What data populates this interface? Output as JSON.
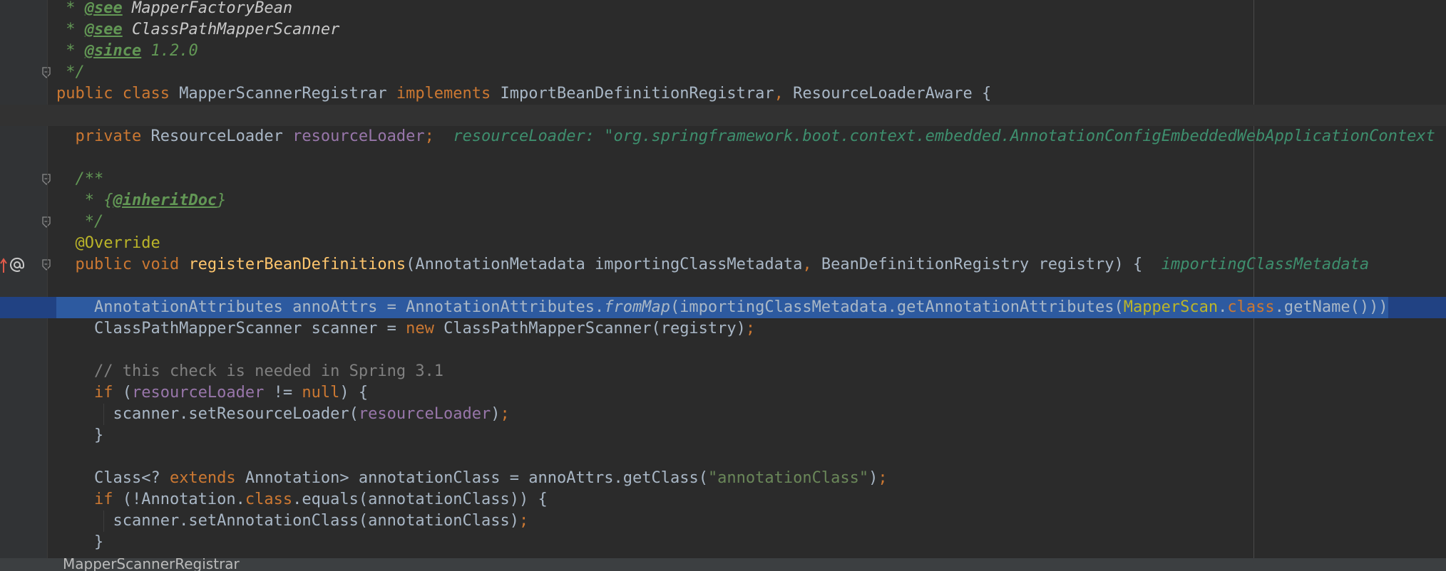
{
  "editor": {
    "lines": [
      {
        "spans": [
          {
            "t": " * ",
            "c": "doc"
          },
          {
            "t": "@see",
            "c": "doctag"
          },
          {
            "t": " MapperFactoryBean",
            "c": "docref"
          }
        ]
      },
      {
        "spans": [
          {
            "t": " * ",
            "c": "doc"
          },
          {
            "t": "@see",
            "c": "doctag"
          },
          {
            "t": " ClassPathMapperScanner",
            "c": "docref"
          }
        ]
      },
      {
        "spans": [
          {
            "t": " * ",
            "c": "doc"
          },
          {
            "t": "@since",
            "c": "doctag"
          },
          {
            "t": " 1.2.0",
            "c": "doc"
          }
        ]
      },
      {
        "spans": [
          {
            "t": " */",
            "c": "doc"
          }
        ]
      },
      {
        "spans": [
          {
            "t": "public class ",
            "c": "kw"
          },
          {
            "t": "MapperScannerRegistrar ",
            "c": "cls"
          },
          {
            "t": "implements ",
            "c": "kw"
          },
          {
            "t": "ImportBeanDefinitionRegistrar",
            "c": "cls"
          },
          {
            "t": ", ",
            "c": "kw"
          },
          {
            "t": "ResourceLoaderAware {",
            "c": "cls"
          }
        ]
      },
      {
        "spans": []
      },
      {
        "spans": [
          {
            "t": "  private ",
            "c": "kw"
          },
          {
            "t": "ResourceLoader ",
            "c": "cls"
          },
          {
            "t": "resourceLoader",
            "c": "fld"
          },
          {
            "t": ";",
            "c": "kw"
          },
          {
            "t": "  resourceLoader: \"org.springframework.boot.context.embedded.AnnotationConfigEmbeddedWebApplicationContext",
            "c": "hint"
          }
        ]
      },
      {
        "spans": []
      },
      {
        "spans": [
          {
            "t": "  /**",
            "c": "doc"
          }
        ]
      },
      {
        "spans": [
          {
            "t": "   * {",
            "c": "doc"
          },
          {
            "t": "@inheritDoc",
            "c": "doctag"
          },
          {
            "t": "}",
            "c": "doc"
          }
        ]
      },
      {
        "spans": [
          {
            "t": "   */",
            "c": "doc"
          }
        ]
      },
      {
        "spans": [
          {
            "t": "  @Override",
            "c": "ann"
          }
        ]
      },
      {
        "spans": [
          {
            "t": "  public void ",
            "c": "kw"
          },
          {
            "t": "registerBeanDefinitions",
            "c": "fn"
          },
          {
            "t": "(AnnotationMetadata importingClassMetadata",
            "c": "cls"
          },
          {
            "t": ", ",
            "c": "kw"
          },
          {
            "t": "BeanDefinitionRegistry registry) {",
            "c": "cls"
          },
          {
            "t": "  importingClassMetadata",
            "c": "hint"
          }
        ]
      },
      {
        "spans": []
      },
      {
        "spans": [
          {
            "t": "    AnnotationAttributes annoAttrs = AnnotationAttributes.",
            "c": "cls"
          },
          {
            "t": "fromMap",
            "c": "ital"
          },
          {
            "t": "(importingClassMetadata.getAnnotationAttributes(",
            "c": "cls"
          },
          {
            "t": "MapperScan",
            "c": "ann-name"
          },
          {
            "t": ".",
            "c": "cls"
          },
          {
            "t": "class",
            "c": "kw"
          },
          {
            "t": ".getName()))",
            "c": "cls"
          }
        ]
      },
      {
        "spans": [
          {
            "t": "    ClassPathMapperScanner scanner = ",
            "c": "cls"
          },
          {
            "t": "new ",
            "c": "kw"
          },
          {
            "t": "ClassPathMapperScanner(registry)",
            "c": "cls"
          },
          {
            "t": ";",
            "c": "kw"
          }
        ]
      },
      {
        "spans": []
      },
      {
        "spans": [
          {
            "t": "    // this check is needed in Spring 3.1",
            "c": "cmt"
          }
        ]
      },
      {
        "spans": [
          {
            "t": "    if ",
            "c": "kw"
          },
          {
            "t": "(",
            "c": "cls"
          },
          {
            "t": "resourceLoader ",
            "c": "fld"
          },
          {
            "t": "!= ",
            "c": "cls"
          },
          {
            "t": "null",
            "c": "kw"
          },
          {
            "t": ") {",
            "c": "cls"
          }
        ]
      },
      {
        "spans": [
          {
            "t": "      scanner.setResourceLoader(",
            "c": "cls"
          },
          {
            "t": "resourceLoader",
            "c": "fld"
          },
          {
            "t": ")",
            "c": "cls"
          },
          {
            "t": ";",
            "c": "kw"
          }
        ]
      },
      {
        "spans": [
          {
            "t": "    }",
            "c": "cls"
          }
        ]
      },
      {
        "spans": []
      },
      {
        "spans": [
          {
            "t": "    Class<? ",
            "c": "cls"
          },
          {
            "t": "extends ",
            "c": "kw"
          },
          {
            "t": "Annotation> annotationClass = annoAttrs.getClass(",
            "c": "cls"
          },
          {
            "t": "\"annotationClass\"",
            "c": "str"
          },
          {
            "t": ")",
            "c": "cls"
          },
          {
            "t": ";",
            "c": "kw"
          }
        ]
      },
      {
        "spans": [
          {
            "t": "    if ",
            "c": "kw"
          },
          {
            "t": "(!Annotation.",
            "c": "cls"
          },
          {
            "t": "class",
            "c": "kw"
          },
          {
            "t": ".equals(annotationClass)) {",
            "c": "cls"
          }
        ]
      },
      {
        "spans": [
          {
            "t": "      scanner.setAnnotationClass(annotationClass)",
            "c": "cls"
          },
          {
            "t": ";",
            "c": "kw"
          }
        ]
      },
      {
        "spans": [
          {
            "t": "    }",
            "c": "cls"
          }
        ]
      }
    ],
    "current_line_index": 5,
    "selected_line_index": 14,
    "breakpoint_line_index": 14,
    "override_marker_line_index": 12,
    "fold_markers": [
      3,
      8,
      10,
      12
    ]
  },
  "gutter_icons": {
    "override": "override-up-arrow-icon",
    "at": "at-sign-icon",
    "breakpoint": "verified-breakpoint-icon",
    "fold": "fold-marker-icon"
  },
  "status": {
    "breadcrumb": "MapperScannerRegistrar"
  },
  "colors": {
    "background": "#2b2b2b",
    "keyword": "#cc7832",
    "field": "#9876aa",
    "method": "#ffc66d",
    "annotation": "#bbb529",
    "string": "#6a8759",
    "doc": "#629755",
    "inlay_hint": "#3e8f6e",
    "selection": "#214283",
    "breakpoint": "#c75450"
  }
}
